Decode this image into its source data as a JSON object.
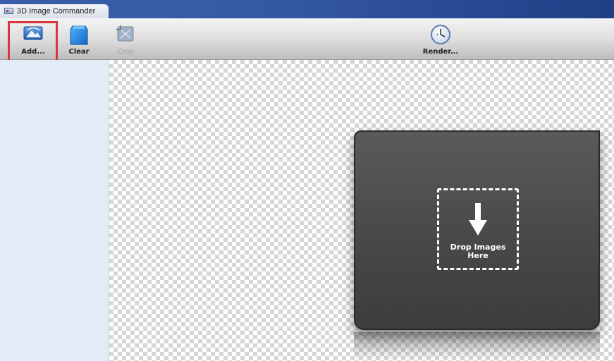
{
  "window": {
    "title": "3D Image Commander"
  },
  "toolbar": {
    "add_label": "Add...",
    "clear_label": "Clear",
    "crop_label": "Crop",
    "render_label": "Render..."
  },
  "canvas": {
    "drop_label": "Drop Images\nHere"
  },
  "icons": {
    "app": "app-icon",
    "add": "add-image-icon",
    "clear": "clear-icon",
    "crop": "crop-icon",
    "render": "render-clock-icon",
    "drop": "arrow-down-icon"
  },
  "colors": {
    "titlebar": "#3a5fa8",
    "highlight": "#d8383b",
    "sidebar": "#e3ebf7",
    "drop_panel": "#4a4a4a"
  }
}
